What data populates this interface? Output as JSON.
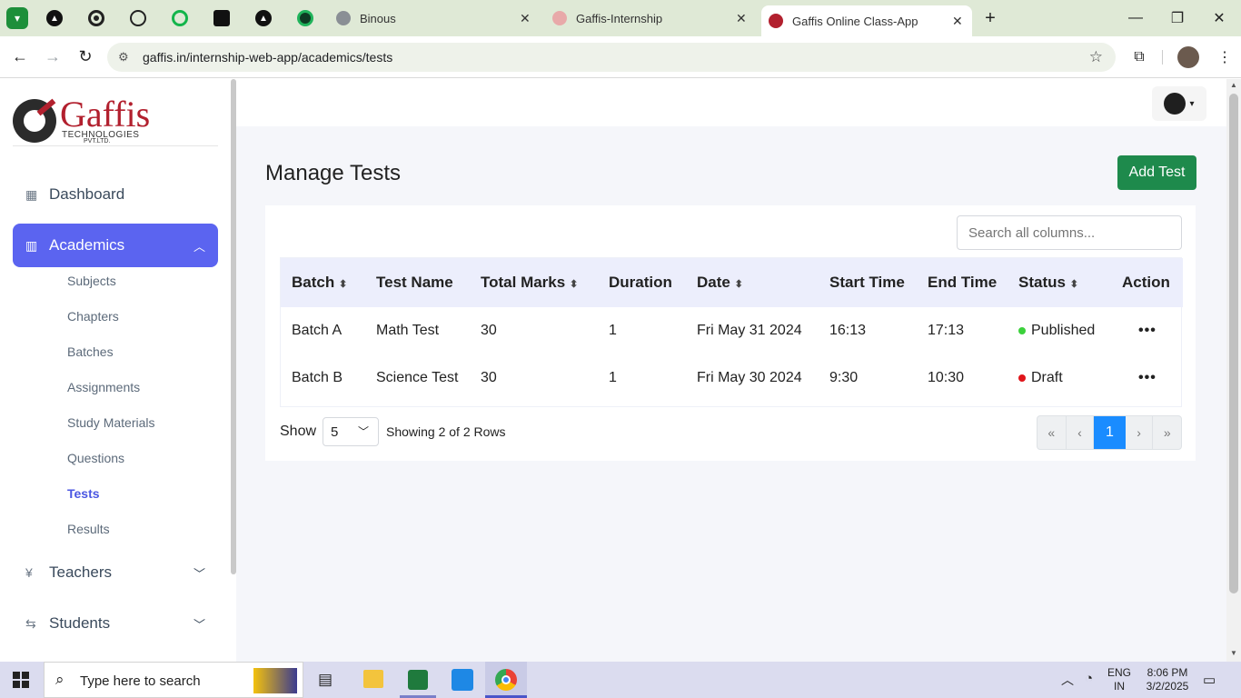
{
  "browser": {
    "tabs": [
      {
        "label": "Binous"
      },
      {
        "label": "Gaffis-Internship"
      },
      {
        "label": "Gaffis Online Class-App"
      }
    ],
    "address": "gaffis.in/internship-web-app/academics/tests"
  },
  "brand": {
    "name": "Gaffis",
    "sub1": "TECHNOLOGIES",
    "sub2": "PVT.LTD."
  },
  "sidebar": {
    "items": [
      {
        "label": "Dashboard"
      },
      {
        "label": "Academics"
      },
      {
        "label": "Teachers"
      },
      {
        "label": "Students"
      }
    ],
    "academics_sub": [
      {
        "label": "Subjects"
      },
      {
        "label": "Chapters"
      },
      {
        "label": "Batches"
      },
      {
        "label": "Assignments"
      },
      {
        "label": "Study Materials"
      },
      {
        "label": "Questions"
      },
      {
        "label": "Tests"
      },
      {
        "label": "Results"
      }
    ]
  },
  "page": {
    "title": "Manage Tests",
    "add_button": "Add Test",
    "search_placeholder": "Search all columns..."
  },
  "table": {
    "headers": [
      "Batch",
      "Test Name",
      "Total Marks",
      "Duration",
      "Date",
      "Start Time",
      "End Time",
      "Status",
      "Action"
    ],
    "rows": [
      {
        "batch": "Batch A",
        "test_name": "Math Test",
        "total_marks": "30",
        "duration": "1",
        "date": "Fri May 31 2024",
        "start": "16:13",
        "end": "17:13",
        "status": "Published",
        "status_color": "#3bd13b"
      },
      {
        "batch": "Batch B",
        "test_name": "Science Test",
        "total_marks": "30",
        "duration": "1",
        "date": "Fri May 30 2024",
        "start": "9:30",
        "end": "10:30",
        "status": "Draft",
        "status_color": "#e0151b"
      }
    ]
  },
  "pagination": {
    "show_label": "Show",
    "page_size": "5",
    "summary": "Showing 2 of 2 Rows",
    "first": "«",
    "prev": "‹",
    "current": "1",
    "next": "›",
    "last": "»"
  },
  "taskbar": {
    "search_placeholder": "Type here to search",
    "lang1": "ENG",
    "lang2": "IN",
    "time": "8:06 PM",
    "date": "3/2/2025"
  },
  "colors": {
    "accent": "#5b64f0",
    "add_button": "#1e8a4c",
    "page_active": "#1a8cff"
  }
}
